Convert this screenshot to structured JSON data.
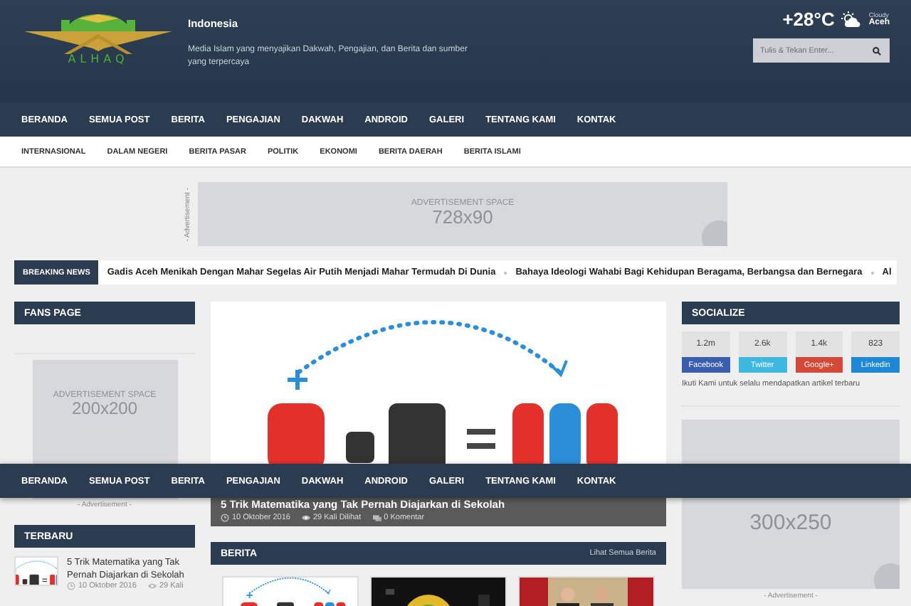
{
  "header": {
    "logo_text": "ALHAQ",
    "site_name": "Indonesia",
    "tagline": "Media Islam yang menyajikan Dakwah, Pengajian, dan Berita dan sumber yang terpercaya",
    "weather": {
      "temperature": "+28°C",
      "condition": "Cloudy",
      "city": "Aceh"
    },
    "search": {
      "placeholder": "Tulis & Tekan Enter..."
    }
  },
  "main_nav": [
    "BERANDA",
    "SEMUA POST",
    "BERITA",
    "PENGAJIAN",
    "DAKWAH",
    "ANDROID",
    "GALERI",
    "TENTANG KAMI",
    "KONTAK"
  ],
  "sub_nav": [
    "INTERNASIONAL",
    "DALAM NEGERI",
    "BERITA PASAR",
    "POLITIK",
    "EKONOMI",
    "BERITA DAERAH",
    "BERITA ISLAMI"
  ],
  "top_ad": {
    "label": "ADVERTISEMENT SPACE",
    "size": "728x90",
    "side_label": "- Advertisement -"
  },
  "breaking_news": {
    "label": "BREAKING NEWS",
    "items": [
      "Gadis Aceh Menikah Dengan Mahar Segelas Air Putih Menjadi Mahar Termudah Di Dunia",
      "Bahaya Ideologi Wahabi Bagi Kehidupan Beragama, Berbangsa dan Bernegara",
      "Al"
    ]
  },
  "fans_page": {
    "title": "FANS PAGE",
    "ad_label": "ADVERTISEMENT SPACE",
    "ad_size": "200x200",
    "ad_caption": "- Advertisement -"
  },
  "terbaru": {
    "title": "TERBARU",
    "posts": [
      {
        "title": "5 Trik Matematika yang Tak Pernah Diajarkan di Sekolah",
        "date": "10 Oktober 2016",
        "views": "29 Kali"
      }
    ]
  },
  "featured": {
    "title": "5 Trik Matematika yang Tak Pernah Diajarkan di Sekolah",
    "date": "10 Oktober 2016",
    "views": "29 Kali Dilihat",
    "comments": "0 Komentar"
  },
  "berita": {
    "title": "BERITA",
    "link": "Lihat Semua Berita"
  },
  "socialize": {
    "title": "SOCIALIZE",
    "networks": [
      {
        "count": "1.2m",
        "name": "Facebook",
        "color": "#3b5db0"
      },
      {
        "count": "2.6k",
        "name": "Twitter",
        "color": "#3fb8e0"
      },
      {
        "count": "1.4k",
        "name": "Google+",
        "color": "#d34836"
      },
      {
        "count": "823",
        "name": "Linkedin",
        "color": "#1f88d6"
      }
    ],
    "note": "Ikuti Kami untuk selalu mendapatkan artikel terbaru"
  },
  "right_ad": {
    "size": "300x250",
    "caption": "- Advertisement -"
  },
  "sticky_nav": [
    "BERANDA",
    "SEMUA POST",
    "BERITA",
    "PENGAJIAN",
    "DAKWAH",
    "ANDROID",
    "GALERI",
    "TENTANG KAMI",
    "KONTAK"
  ]
}
